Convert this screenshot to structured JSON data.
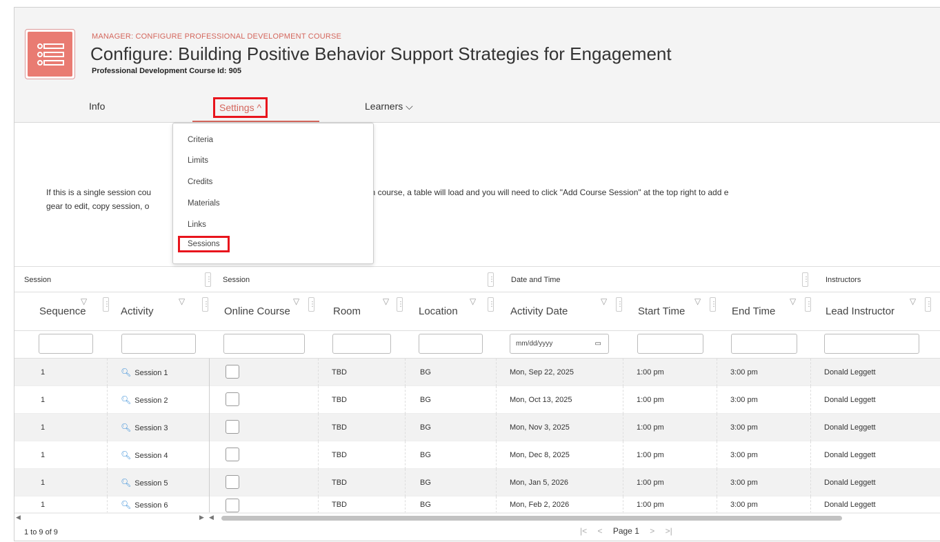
{
  "header": {
    "breadcrumb": "MANAGER: CONFIGURE PROFESSIONAL DEVELOPMENT COURSE",
    "title": "Configure: Building Positive Behavior Support Strategies for Engagement",
    "subtitle": "Professional Development Course Id: 905",
    "accent_color": "#d4665c"
  },
  "tabs": {
    "info": "Info",
    "settings": "Settings ^",
    "learners": "Learners ⌵"
  },
  "settings_menu": [
    "Criteria",
    "Limits",
    "Credits",
    "Materials",
    "Links",
    "Sessions"
  ],
  "intro": {
    "line1_left": "If this is a single session cou",
    "line1_right": "lay.  If this is a multi-session course, a table will load and you will need to click \"Add Course Session\" at the top right to add e",
    "line2": "gear to edit, copy session, o"
  },
  "table": {
    "groups": [
      "Session",
      "Session",
      "Date and Time",
      "Instructors"
    ],
    "columns": [
      "Sequence",
      "Activity",
      "Online Course",
      "Room",
      "Location",
      "Activity Date",
      "Start Time",
      "End Time",
      "Lead Instructor"
    ],
    "date_placeholder": "mm/dd/yyyy",
    "rows": [
      {
        "sequence": "1",
        "activity": "Session 1",
        "room": "TBD",
        "location": "BG",
        "date": "Mon, Sep 22, 2025",
        "start": "1:00 pm",
        "end": "3:00 pm",
        "instructor": "Donald Leggett"
      },
      {
        "sequence": "1",
        "activity": "Session 2",
        "room": "TBD",
        "location": "BG",
        "date": "Mon, Oct 13, 2025",
        "start": "1:00 pm",
        "end": "3:00 pm",
        "instructor": "Donald Leggett"
      },
      {
        "sequence": "1",
        "activity": "Session 3",
        "room": "TBD",
        "location": "BG",
        "date": "Mon, Nov 3, 2025",
        "start": "1:00 pm",
        "end": "3:00 pm",
        "instructor": "Donald Leggett"
      },
      {
        "sequence": "1",
        "activity": "Session 4",
        "room": "TBD",
        "location": "BG",
        "date": "Mon, Dec 8, 2025",
        "start": "1:00 pm",
        "end": "3:00 pm",
        "instructor": "Donald Leggett"
      },
      {
        "sequence": "1",
        "activity": "Session 5",
        "room": "TBD",
        "location": "BG",
        "date": "Mon, Jan 5, 2026",
        "start": "1:00 pm",
        "end": "3:00 pm",
        "instructor": "Donald Leggett"
      },
      {
        "sequence": "1",
        "activity": "Session 6",
        "room": "TBD",
        "location": "BG",
        "date": "Mon, Feb 2, 2026",
        "start": "1:00 pm",
        "end": "3:00 pm",
        "instructor": "Donald Leggett"
      }
    ]
  },
  "footer": {
    "count": "1 to 9 of 9",
    "first": "|<",
    "prev": "<",
    "page": "Page 1",
    "next": ">",
    "last": ">|"
  },
  "icons": [
    "list-settings-icon",
    "filter-icon",
    "column-menu-icon",
    "search-icon",
    "calendar-icon"
  ]
}
